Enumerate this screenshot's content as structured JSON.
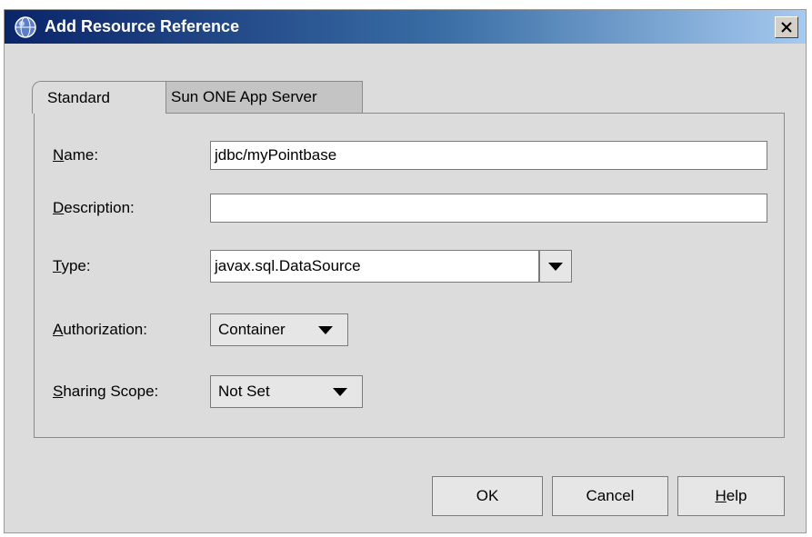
{
  "window": {
    "title": "Add Resource Reference"
  },
  "tabs": [
    {
      "label": "Standard",
      "selected": true
    },
    {
      "label": "Sun ONE App Server",
      "selected": false
    }
  ],
  "form": {
    "name": {
      "label_mnemonic": "N",
      "label_rest": "ame:",
      "value": "jdbc/myPointbase"
    },
    "description": {
      "label_mnemonic": "D",
      "label_rest": "escription:",
      "value": ""
    },
    "type": {
      "label_mnemonic": "T",
      "label_rest": "ype:",
      "value": "javax.sql.DataSource"
    },
    "authorization": {
      "label_mnemonic": "A",
      "label_rest": "uthorization:",
      "value": "Container"
    },
    "sharing_scope": {
      "label_mnemonic": "S",
      "label_rest": "haring Scope:",
      "value": "Not Set"
    }
  },
  "buttons": {
    "ok": "OK",
    "cancel": "Cancel",
    "help_mnemonic": "H",
    "help_rest": "elp"
  },
  "icons": {
    "title": "app-globe-icon",
    "close": "close-icon",
    "dropdown": "chevron-down-icon"
  }
}
